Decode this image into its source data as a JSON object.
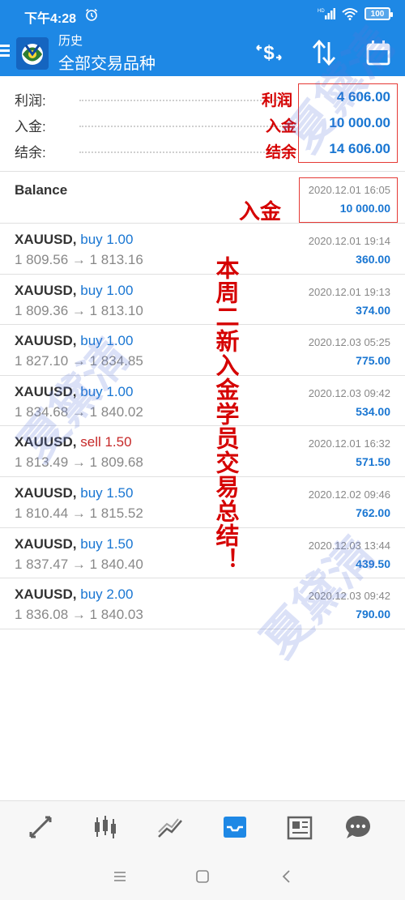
{
  "status_bar": {
    "time": "下午4:28",
    "battery": "100"
  },
  "header": {
    "subtitle": "历史",
    "title": "全部交易品种"
  },
  "summary": [
    {
      "label": "利润:",
      "note": "利润",
      "value": "4 606.00"
    },
    {
      "label": "入金:",
      "note": "入金",
      "value": "10 000.00"
    },
    {
      "label": "结余:",
      "note": "结余",
      "value": "14 606.00"
    }
  ],
  "balance": {
    "title": "Balance",
    "note": "入金",
    "date": "2020.12.01 16:05",
    "amount": "10 000.00"
  },
  "deals": [
    {
      "symbol": "XAUUSD,",
      "type": "buy 1.00",
      "side": "buy",
      "prices": "1 809.56 → 1 813.16",
      "date": "2020.12.01 19:14",
      "profit": "360.00"
    },
    {
      "symbol": "XAUUSD,",
      "type": "buy 1.00",
      "side": "buy",
      "prices": "1 809.36 → 1 813.10",
      "date": "2020.12.01 19:13",
      "profit": "374.00"
    },
    {
      "symbol": "XAUUSD,",
      "type": "buy 1.00",
      "side": "buy",
      "prices": "1 827.10 → 1 834.85",
      "date": "2020.12.03 05:25",
      "profit": "775.00"
    },
    {
      "symbol": "XAUUSD,",
      "type": "buy 1.00",
      "side": "buy",
      "prices": "1 834.68 → 1 840.02",
      "date": "2020.12.03 09:42",
      "profit": "534.00"
    },
    {
      "symbol": "XAUUSD,",
      "type": "sell 1.50",
      "side": "sell",
      "prices": "1 813.49 → 1 809.68",
      "date": "2020.12.01 16:32",
      "profit": "571.50"
    },
    {
      "symbol": "XAUUSD,",
      "type": "buy 1.50",
      "side": "buy",
      "prices": "1 810.44 → 1 815.52",
      "date": "2020.12.02 09:46",
      "profit": "762.00"
    },
    {
      "symbol": "XAUUSD,",
      "type": "buy 1.50",
      "side": "buy",
      "prices": "1 837.47 → 1 840.40",
      "date": "2020.12.03 13:44",
      "profit": "439.50"
    },
    {
      "symbol": "XAUUSD,",
      "type": "buy 2.00",
      "side": "buy",
      "prices": "1 836.08 → 1 840.03",
      "date": "2020.12.03 09:42",
      "profit": "790.00"
    }
  ],
  "vertical_note": "本周二新入金学员交易总结！",
  "watermark_text": "夏黛清",
  "colors": {
    "accent": "#1e88e5",
    "profit": "#1976d2",
    "sell": "#c62828",
    "note_red": "#d50000"
  },
  "icons": {
    "appbar": [
      "currency-exchange-icon",
      "sort-icon",
      "calendar-icon"
    ],
    "bottom_nav": [
      "quotes-icon",
      "chart-icon",
      "trade-icon",
      "history-icon",
      "news-icon",
      "chat-icon"
    ],
    "system_nav": [
      "recent-apps-icon",
      "home-icon",
      "back-icon"
    ]
  }
}
